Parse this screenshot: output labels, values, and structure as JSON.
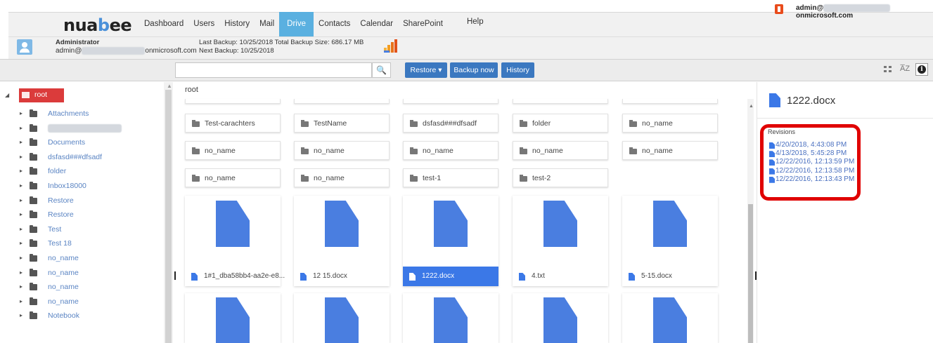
{
  "brand": {
    "logo_pre": "nua",
    "logo_b": "b",
    "logo_post": "ee"
  },
  "nav": {
    "items": [
      "Dashboard",
      "Users",
      "History",
      "Mail",
      "Drive",
      "Contacts",
      "Calendar",
      "SharePoint"
    ],
    "active": "Drive",
    "help": "Help"
  },
  "account": {
    "prefix": "admin@",
    "suffix": "onmicrosoft.com"
  },
  "user": {
    "name": "Administrator",
    "mail_prefix": "admin@",
    "mail_suffix": "onmicrosoft.com",
    "last_backup": "Last Backup:  10/25/2018  Total Backup Size:  686.17 MB",
    "next_backup": "Next Backup:  10/25/2018"
  },
  "toolbar": {
    "search_placeholder": "",
    "restore": "Restore ▾",
    "backup_now": "Backup now",
    "history": "History",
    "sort_icon_text": "A̅Z"
  },
  "sidebar": {
    "root": "root",
    "items": [
      "Attachments",
      "",
      "Documents",
      "dsfasd###dfsadf",
      "folder",
      "Inbox18000",
      "Restore",
      "Restore",
      "Test",
      "Test 18",
      "no_name",
      "no_name",
      "no_name",
      "no_name",
      "Notebook"
    ]
  },
  "main": {
    "breadcrumb": "root",
    "folders": [
      [
        "Test-carachters",
        "TestName",
        "dsfasd###dfsadf",
        "folder",
        "no_name"
      ],
      [
        "no_name",
        "no_name",
        "no_name",
        "no_name",
        "no_name"
      ],
      [
        "no_name",
        "no_name",
        "test-1",
        "test-2"
      ]
    ],
    "files": [
      "1#1_dba58bb4-aa2e-e8...",
      "12 15.docx",
      "1222.docx",
      "4.txt",
      "5-15.docx"
    ],
    "selected_file": "1222.docx"
  },
  "details": {
    "title": "1222.docx",
    "revisions_label": "Revisions",
    "revisions": [
      "4/20/2018, 4:43:08 PM",
      "4/13/2018, 5:45:28 PM",
      "12/22/2016, 12:13:59 PM",
      "12/22/2016, 12:13:58 PM",
      "12/22/2016, 12:13:43 PM"
    ]
  },
  "colors": {
    "accent": "#3b78c0",
    "nav_active": "#5ab0e0",
    "root_selected": "#db3b3b",
    "doc_blue": "#4a7ee0",
    "highlight": "#e00000"
  }
}
